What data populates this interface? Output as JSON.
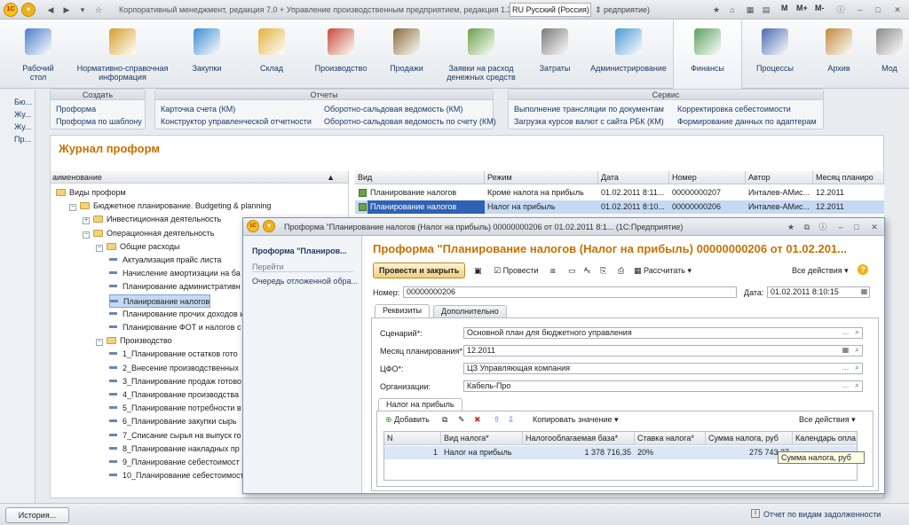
{
  "window": {
    "title": "Корпоративный менеджмент, редакция 7.0 + Управление производственным предприятием, редакция 1.3",
    "lang": "RU Русский (Россия)",
    "lang_suffix": "редприятие)",
    "m": "M",
    "mplus": "M+",
    "mminus": "M-"
  },
  "sections": [
    {
      "id": "desktop",
      "label": "Рабочий\nстол"
    },
    {
      "id": "ref",
      "label": "Нормативно-справочная\nинформация"
    },
    {
      "id": "purchases",
      "label": "Закупки"
    },
    {
      "id": "warehouse",
      "label": "Склад"
    },
    {
      "id": "production",
      "label": "Производство"
    },
    {
      "id": "sales",
      "label": "Продажи"
    },
    {
      "id": "cashreq",
      "label": "Заявки на расход\nденежных средств"
    },
    {
      "id": "costs",
      "label": "Затраты"
    },
    {
      "id": "admin",
      "label": "Администрирование"
    },
    {
      "id": "finance",
      "label": "Финансы"
    },
    {
      "id": "processes",
      "label": "Процессы"
    },
    {
      "id": "archive",
      "label": "Архив"
    },
    {
      "id": "more",
      "label": "Мод"
    }
  ],
  "leftbar": [
    "Бю...",
    "Жу...",
    "Жу...",
    "Пр..."
  ],
  "actions": {
    "create": {
      "header": "Создать",
      "items": [
        "Проформа",
        "Проформа по шаблону"
      ]
    },
    "reports": {
      "header": "Отчеты",
      "items": [
        "Карточка счета (КМ)",
        "Конструктор управленческой отчетности",
        "Оборотно-сальдовая ведомость (КМ)",
        "Оборотно-сальдовая ведомость по счету (КМ)"
      ]
    },
    "service": {
      "header": "Сервис",
      "items": [
        "Выполнение трансляции по документам",
        "Загрузка курсов валют с сайта РБК (КМ)",
        "Корректировка себестоимости",
        "Формирование данных по адаптерам"
      ]
    }
  },
  "journal": {
    "title": "Журнал проформ",
    "tree_header": "аименование",
    "tree": [
      {
        "t": "Виды проформ",
        "lvl": 0,
        "kind": "folder",
        "pm": ""
      },
      {
        "t": "Бюджетное планирование. Budgeting & planning",
        "lvl": 1,
        "kind": "folder",
        "pm": "−"
      },
      {
        "t": "Инвестиционная деятельность",
        "lvl": 2,
        "kind": "folder",
        "pm": "+"
      },
      {
        "t": "Операционная деятельность",
        "lvl": 2,
        "kind": "folder",
        "pm": "−"
      },
      {
        "t": "Общие расходы",
        "lvl": 3,
        "kind": "folder",
        "pm": "−"
      },
      {
        "t": "Актуализация прайс листа",
        "lvl": 4,
        "kind": "leaf"
      },
      {
        "t": "Начисление амортизации на ба",
        "lvl": 4,
        "kind": "leaf"
      },
      {
        "t": "Планирование административн",
        "lvl": 4,
        "kind": "leaf"
      },
      {
        "t": "Планирование налогов",
        "lvl": 4,
        "kind": "leaf",
        "sel": true
      },
      {
        "t": "Планирование прочих доходов и",
        "lvl": 4,
        "kind": "leaf"
      },
      {
        "t": "Планирование ФОТ и налогов с",
        "lvl": 4,
        "kind": "leaf"
      },
      {
        "t": "Производство",
        "lvl": 3,
        "kind": "folder",
        "pm": "−"
      },
      {
        "t": "1_Планирование остатков гото",
        "lvl": 4,
        "kind": "leaf"
      },
      {
        "t": "2_Внесение производственных",
        "lvl": 4,
        "kind": "leaf"
      },
      {
        "t": "3_Планирование продаж готово",
        "lvl": 4,
        "kind": "leaf"
      },
      {
        "t": "4_Планирование производства",
        "lvl": 4,
        "kind": "leaf"
      },
      {
        "t": "5_Планирование потребности в",
        "lvl": 4,
        "kind": "leaf"
      },
      {
        "t": "6_Планирование закупки сырь",
        "lvl": 4,
        "kind": "leaf"
      },
      {
        "t": "7_Списание сырья на выпуск го",
        "lvl": 4,
        "kind": "leaf"
      },
      {
        "t": "8_Планирование накладных пр",
        "lvl": 4,
        "kind": "leaf"
      },
      {
        "t": "9_Планирование себестоимост",
        "lvl": 4,
        "kind": "leaf"
      },
      {
        "t": "10_Планирование себестоимост",
        "lvl": 4,
        "kind": "leaf"
      }
    ],
    "grid": {
      "cols": [
        "Вид",
        "Режим",
        "Дата",
        "Номер",
        "Автор",
        "Месяц планиро"
      ],
      "rows": [
        [
          "Планирование налогов",
          "Кроме налога на прибыль",
          "01.02.2011 8:11...",
          "00000000207",
          "Инталев-АМис...",
          "12.2011"
        ],
        [
          "Планирование налогов",
          "Налог на прибыль",
          "01.02.2011 8:10...",
          "00000000206",
          "Инталев-АМис...",
          "12.2011"
        ]
      ]
    }
  },
  "modal": {
    "title": "Проформа \"Планирование налогов (Налог на прибыль) 00000000206 от 01.02.2011 8:1...  (1С:Предприятие)",
    "left_title": "Проформа \"Планиров...",
    "goto": "Перейти",
    "goto_item": "Очередь отложенной обра...",
    "heading": "Проформа \"Планирование налогов (Налог на прибыль)  00000000206 от 01.02.201...",
    "toolbar": {
      "post_close": "Провести и закрыть",
      "post": "Провести",
      "calc": "Рассчитать ▾",
      "all_actions": "Все действия ▾"
    },
    "number_label": "Номер:",
    "number": "00000000206",
    "date_label": "Дата:",
    "date": "01.02.2011  8:10:15",
    "tabs": [
      "Реквизиты",
      "Дополнительно"
    ],
    "fields": [
      {
        "label": "Сценарий*:",
        "value": "Основной план для бюджетного управления"
      },
      {
        "label": "Месяц планирования*:",
        "value": "12.2011"
      },
      {
        "label": "ЦФО*:",
        "value": "ЦЗ Управляющая компания"
      },
      {
        "label": "Организации:",
        "value": "Кабель-Про"
      }
    ],
    "subtab": "Налог на прибыль",
    "subtoolbar": {
      "add": "Добавить",
      "copy_value": "Копировать значение ▾",
      "all_actions": "Все действия ▾"
    },
    "table": {
      "cols": [
        "N",
        "Вид налога*",
        "Налогооблагаемая база*",
        "Ставка налога*",
        "Сумма налога, руб",
        "Календарь опла"
      ],
      "rows": [
        [
          "1",
          "Налог на прибыль",
          "1 378 716,35",
          "20%",
          "275 743,27",
          ""
        ]
      ]
    },
    "tooltip": "Сумма налога, руб"
  },
  "status": {
    "history": "История...",
    "text": "Отчет по видам задолженности"
  }
}
